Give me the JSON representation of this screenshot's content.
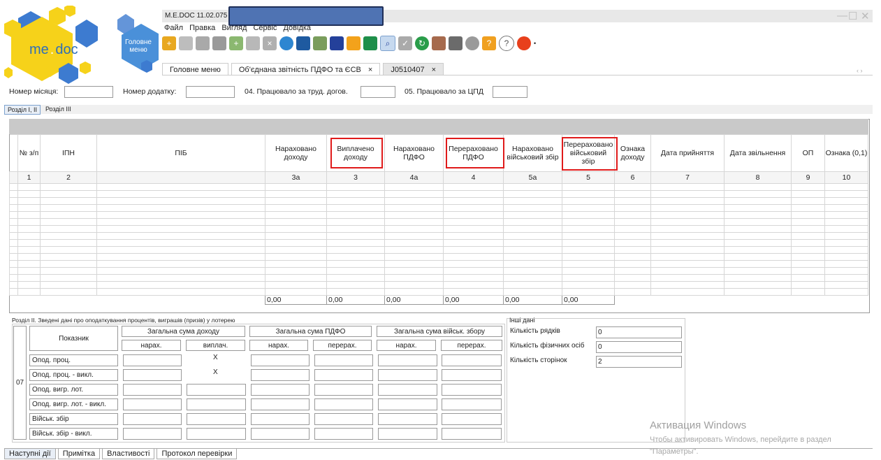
{
  "logo": {
    "text_me": "me",
    "text_doc": "doc",
    "main_menu_label": "Головне меню"
  },
  "window": {
    "title": "M.E.DOC 11.02.075 -",
    "minimize": "—",
    "maximize": "☐",
    "close": "✕"
  },
  "menu": [
    "Файл",
    "Правка",
    "Вигляд",
    "Сервіс",
    "Довідка"
  ],
  "tabs": [
    {
      "label": "Головне меню"
    },
    {
      "label": "Об'єднана звітність ПДФО та ЄСВ",
      "close": "×"
    },
    {
      "label": "J0510407",
      "close": "×"
    }
  ],
  "tab_scroll": "‹ ›",
  "form_fields": {
    "month_label": "Номер місяця:",
    "addendum_label": "Номер додатку:",
    "worked_contract_label": "04. Працювало за труд. догов.",
    "worked_civil_label": "05. Працювало за ЦПД"
  },
  "subtabs": [
    "Розділ І, ІІ",
    "Розділ ІІІ"
  ],
  "grid": {
    "headers": [
      "№ з/п",
      "ІПН",
      "ПІБ",
      "Нараховано доходу",
      "Виплачено доходу",
      "Нараховано ПДФО",
      "Перераховано ПДФО",
      "Нараховано військовий збір",
      "Перераховано військовий збір",
      "Ознака доходу",
      "Дата прийняття",
      "Дата звільнення",
      "ОП",
      "Ознака (0,1)"
    ],
    "numbers": [
      "1",
      "2",
      "",
      "3а",
      "3",
      "4а",
      "4",
      "5а",
      "5",
      "6",
      "7",
      "8",
      "9",
      "10"
    ],
    "totals": [
      "0,00",
      "0,00",
      "0,00",
      "0,00",
      "0,00",
      "0,00"
    ]
  },
  "section2": {
    "title": "Розділ ІІ. Зведені дані про оподаткування процентів, виграшів (призів) у лотерею",
    "row_code": "07",
    "indicator_header": "Показник",
    "group_headers": [
      "Загальна сума доходу",
      "Загальна сума ПДФО",
      "Загальна сума військ. збору"
    ],
    "sub_headers": [
      "нарах.",
      "виплач.",
      "нарах.",
      "перерах.",
      "нарах.",
      "перерах."
    ],
    "rows": [
      "Опод. проц.",
      "Опод. проц. - викл.",
      "Опод. вигр. лот.",
      "Опод. вигр. лот. - викл.",
      "Військ. збір",
      "Військ. збір - викл."
    ],
    "x_mark": "X"
  },
  "other": {
    "title": "Інші дані",
    "rows_label": "Кількість рядків",
    "rows_value": "0",
    "persons_label": "Кількість фізичних осіб",
    "persons_value": "0",
    "pages_label": "Кількість сторінок",
    "pages_value": "2"
  },
  "activation": {
    "line1": "Активация Windows",
    "line2": "Чтобы активировать Windows, перейдите в раздел \"Параметры\"."
  },
  "bottom_tabs": [
    "Наступні дії",
    "Примітка",
    "Властивості",
    "Протокол перевірки"
  ],
  "colors": {
    "highlight": "#e01b1b",
    "logo_yellow": "#f6d21a",
    "logo_blue": "#3d7bd0"
  }
}
